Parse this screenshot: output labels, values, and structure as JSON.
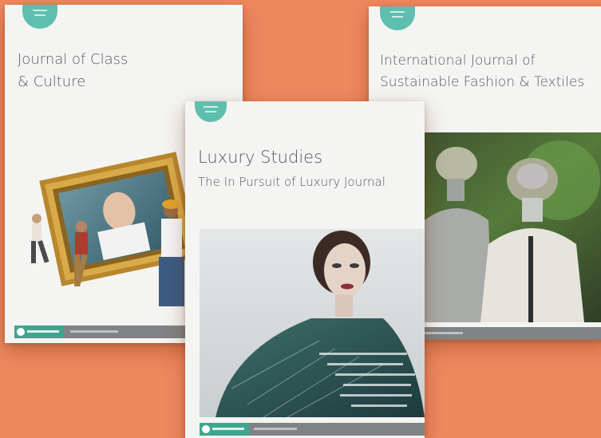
{
  "covers": {
    "class_culture": {
      "title_line1": "Journal of Class",
      "title_line2": "& Culture"
    },
    "sustainable": {
      "title_line1": "International Journal of",
      "title_line2": "Sustainable Fashion & Textiles"
    },
    "luxury": {
      "title_line1": "Luxury Studies",
      "title_line2": "The In Pursuit of Luxury Journal"
    }
  },
  "colors": {
    "background": "#f0885e",
    "badge": "#5fbfae",
    "footer_logo": "#3fa58f",
    "frame_gold": "#c79b3a"
  }
}
